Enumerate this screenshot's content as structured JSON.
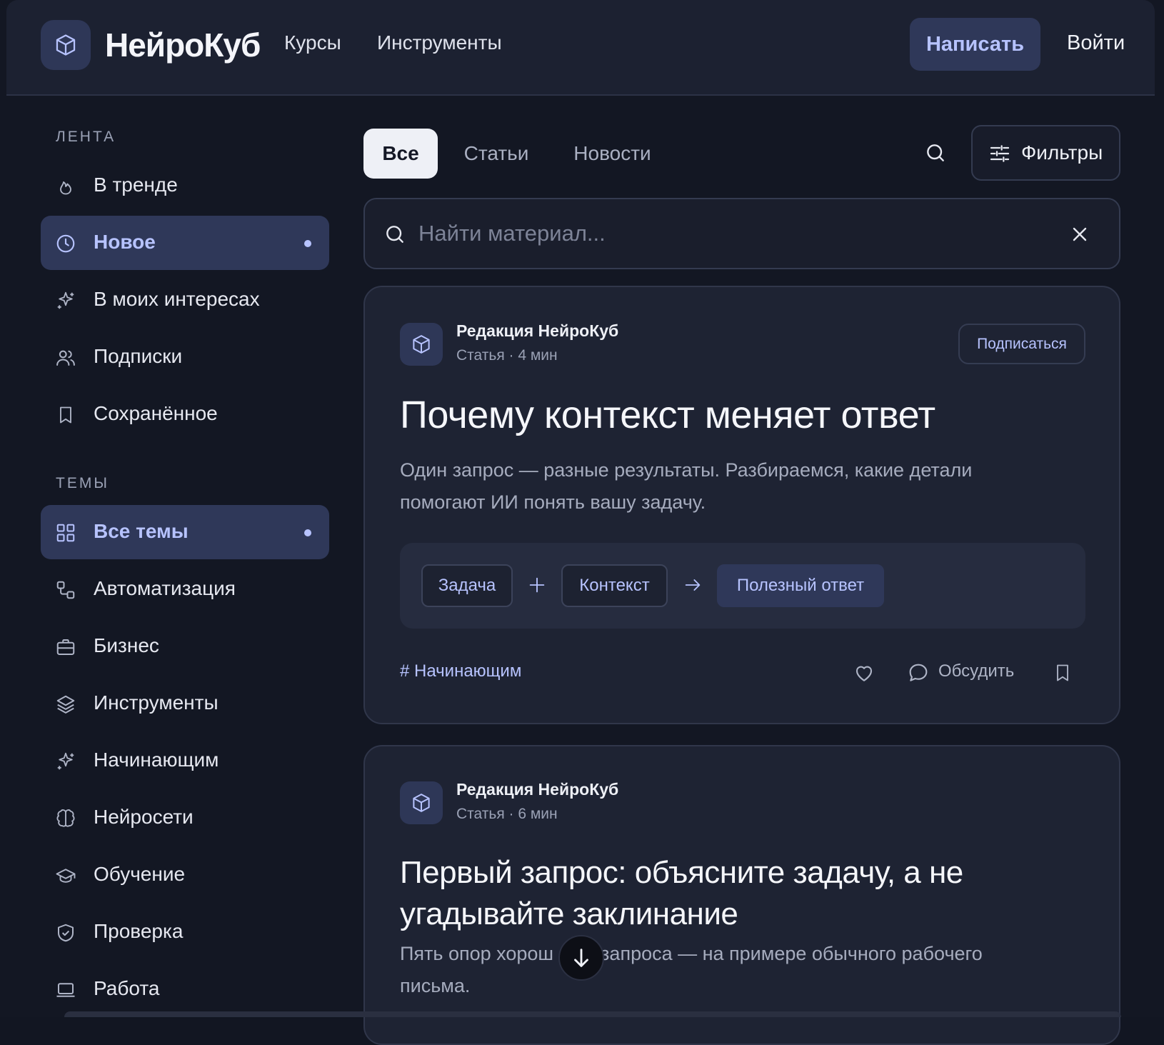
{
  "header": {
    "brand": "НейроКуб",
    "nav": [
      "Курсы",
      "Инструменты"
    ],
    "write_label": "Написать",
    "login_label": "Войти"
  },
  "sidebar": {
    "feed_title": "ЛЕНТА",
    "feed_items": [
      {
        "label": "В тренде",
        "icon": "flame-icon",
        "active": false
      },
      {
        "label": "Новое",
        "icon": "clock-icon",
        "active": true
      },
      {
        "label": "В моих интересах",
        "icon": "sparkles-icon",
        "active": false
      },
      {
        "label": "Подписки",
        "icon": "users-icon",
        "active": false
      },
      {
        "label": "Сохранённое",
        "icon": "bookmark-icon",
        "active": false
      }
    ],
    "topics_title": "ТЕМЫ",
    "topic_items": [
      {
        "label": "Все темы",
        "icon": "grid-icon",
        "active": true
      },
      {
        "label": "Автоматизация",
        "icon": "workflow-icon",
        "active": false
      },
      {
        "label": "Бизнес",
        "icon": "briefcase-icon",
        "active": false
      },
      {
        "label": "Инструменты",
        "icon": "layers-icon",
        "active": false
      },
      {
        "label": "Начинающим",
        "icon": "sparkles-icon",
        "active": false
      },
      {
        "label": "Нейросети",
        "icon": "brain-icon",
        "active": false
      },
      {
        "label": "Обучение",
        "icon": "graduation-cap-icon",
        "active": false
      },
      {
        "label": "Проверка",
        "icon": "shield-check-icon",
        "active": false
      },
      {
        "label": "Работа",
        "icon": "laptop-icon",
        "active": false
      }
    ]
  },
  "tabs": [
    {
      "label": "Все",
      "active": true
    },
    {
      "label": "Статьи",
      "active": false
    },
    {
      "label": "Новости",
      "active": false
    }
  ],
  "filters_label": "Фильтры",
  "search": {
    "placeholder": "Найти материал...",
    "value": ""
  },
  "posts": [
    {
      "author": "Редакция НейроКуб",
      "meta": "Статья · 4 мин",
      "subscribe_label": "Подписаться",
      "title": "Почему контекст меняет ответ",
      "subtitle_lines": [
        "Один запрос — разные результаты. Разбираемся, какие детали",
        "помогают ИИ понять вашу задачу."
      ],
      "flow": {
        "task": "Задача",
        "context": "Контекст",
        "result": "Полезный ответ"
      },
      "tag": "# Начинающим",
      "discuss_label": "Обсудить"
    },
    {
      "author": "Редакция НейроКуб",
      "meta": "Статья · 6 мин",
      "title_lines": [
        "Первый запрос: объясните задачу, а не",
        "угадывайте заклинание"
      ],
      "subtitle_parts": [
        "Пять опор хорош",
        "запроса — на примере обычного рабочего"
      ],
      "subtitle_line2": "письма."
    }
  ],
  "colors": {
    "background": "#131723",
    "surface": "#1e2333",
    "accent": "#b7c3ff",
    "accent_bg": "#2f3859"
  }
}
